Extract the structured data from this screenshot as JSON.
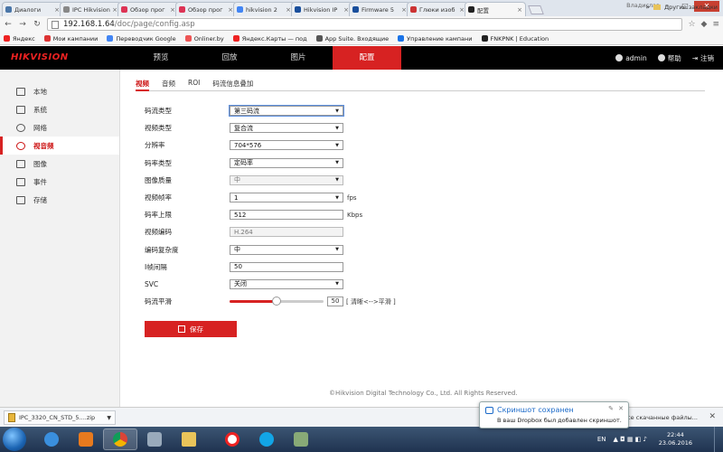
{
  "browser": {
    "user_label": "Владислав",
    "tabs": [
      {
        "title": "Диалоги",
        "color": "#4a76a8"
      },
      {
        "title": "IPC Hikvision",
        "color": "#888"
      },
      {
        "title": "Обзор прог",
        "color": "#d35"
      },
      {
        "title": "Обзор прог",
        "color": "#d35"
      },
      {
        "title": "hikvision 2",
        "color": "#4285f4"
      },
      {
        "title": "Hikvision IP",
        "color": "#1a4f9c"
      },
      {
        "title": "Firmware 5",
        "color": "#1a4f9c"
      },
      {
        "title": "Глюки изоб",
        "color": "#c33"
      },
      {
        "title": "配置",
        "color": "#222"
      }
    ],
    "url_host": "192.168.1.64",
    "url_path": "/doc/page/config.asp",
    "bookmarks": [
      "Яндекс",
      "Мои кампании",
      "Переводчик Google",
      "Onliner.by",
      "Яндекс.Карты — под",
      "App Suite. Входящие",
      "Управление кампани",
      "FNKPNK | Education"
    ],
    "bookmarks_more": "»",
    "bookmarks_other": "Другие закладки"
  },
  "app": {
    "logo": "HIKVISION",
    "nav": [
      "预览",
      "回放",
      "图片",
      "配置"
    ],
    "user": "admin",
    "help": "帮助",
    "logout": "注销"
  },
  "sidebar": {
    "items": [
      "本地",
      "系统",
      "网络",
      "视音频",
      "图像",
      "事件",
      "存储"
    ]
  },
  "subtabs": [
    "视频",
    "音频",
    "ROI",
    "码流信息叠加"
  ],
  "form": {
    "stream_type": {
      "label": "码流类型",
      "value": "第三码流"
    },
    "video_type": {
      "label": "视频类型",
      "value": "复合流"
    },
    "resolution": {
      "label": "分辨率",
      "value": "704*576"
    },
    "bitrate_type": {
      "label": "码率类型",
      "value": "定码率"
    },
    "image_quality": {
      "label": "图像质量",
      "value": "中"
    },
    "frame_rate": {
      "label": "视频帧率",
      "value": "1",
      "unit": "fps"
    },
    "max_bitrate": {
      "label": "码率上限",
      "value": "512",
      "unit": "Kbps"
    },
    "video_encoding": {
      "label": "视频编码",
      "value": "H.264"
    },
    "complexity": {
      "label": "编码复杂度",
      "value": "中"
    },
    "i_frame": {
      "label": "I帧间隔",
      "value": "50"
    },
    "svc": {
      "label": "SVC",
      "value": "关闭"
    },
    "smoothing": {
      "label": "码流平滑",
      "value": "50",
      "fraction": 0.5,
      "hint": "[ 清晰<-->平滑 ]"
    }
  },
  "save_label": "保存",
  "copyright": "©Hikvision Digital Technology Co., Ltd. All Rights Reserved.",
  "download": {
    "file": "IPC_3320_CN_STD_5....zip",
    "show_all": "Все скачанные файлы..."
  },
  "toast": {
    "title": "Скриншот сохранен",
    "message": "В ваш Dropbox был добавлен скриншот."
  },
  "taskbar": {
    "lang": "EN",
    "time": "22:44",
    "date": "23.06.2016"
  }
}
